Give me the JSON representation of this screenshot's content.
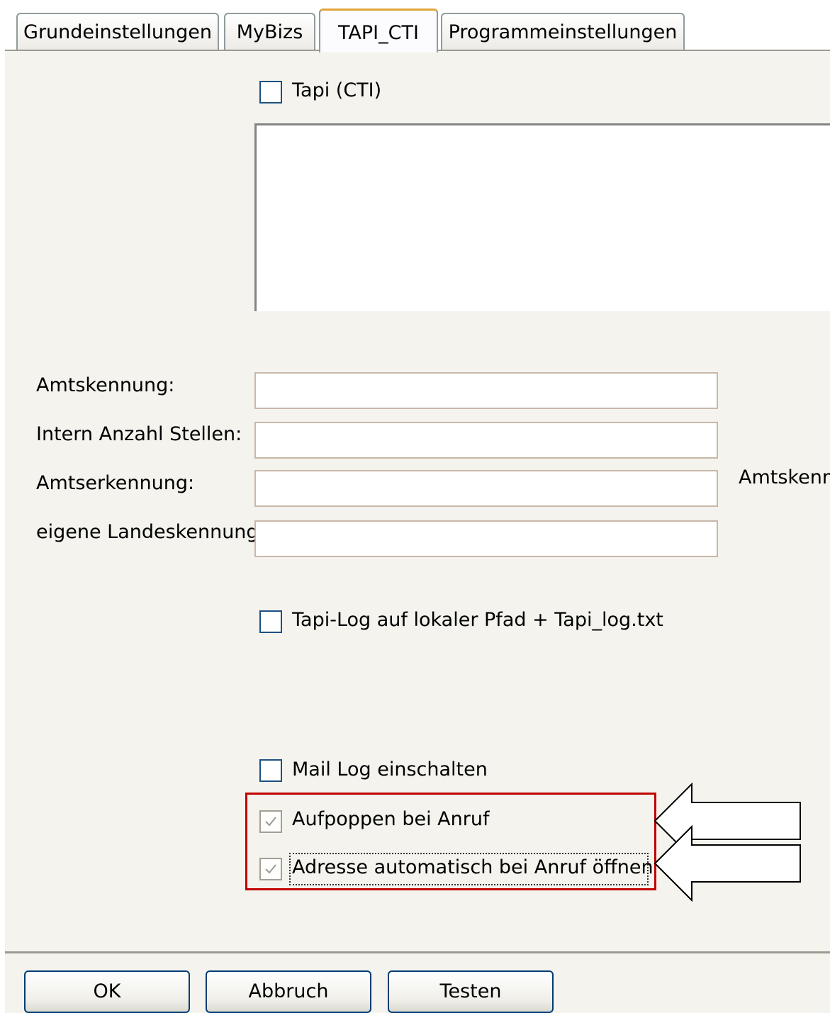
{
  "tabs": [
    "Grundeinstellungen",
    "MyBizs",
    "TAPI_CTI",
    "Programmeinstellungen"
  ],
  "active_tab": "TAPI_CTI",
  "tapi_checkbox": {
    "label": "Tapi (CTI)",
    "checked": false
  },
  "fields": {
    "amtskennung": {
      "label": "Amtskennung:",
      "value": ""
    },
    "intern_stellen": {
      "label": "Intern Anzahl Stellen:",
      "value": ""
    },
    "amtserkennung": {
      "label": "Amtserkennung:",
      "value": ""
    },
    "landeskennung": {
      "label": "eigene Landeskennung:",
      "value": ""
    }
  },
  "side_label": "Amtskenn",
  "tapi_log_checkbox": {
    "label": "Tapi-Log auf lokaler Pfad + Tapi_log.txt",
    "checked": false
  },
  "mail_log_checkbox": {
    "label": "Mail Log einschalten",
    "checked": false
  },
  "aufpoppen_checkbox": {
    "label": "Aufpoppen bei Anruf",
    "checked": true
  },
  "adresse_checkbox": {
    "label": "Adresse automatisch bei Anruf öffnen",
    "checked": true
  },
  "buttons": {
    "ok": "OK",
    "abbruch": "Abbruch",
    "testen": "Testen"
  },
  "colors": {
    "highlight_box": "#c00000",
    "checkbox_border": "#1c5180",
    "active_tab_accent": "#e0a43a"
  }
}
